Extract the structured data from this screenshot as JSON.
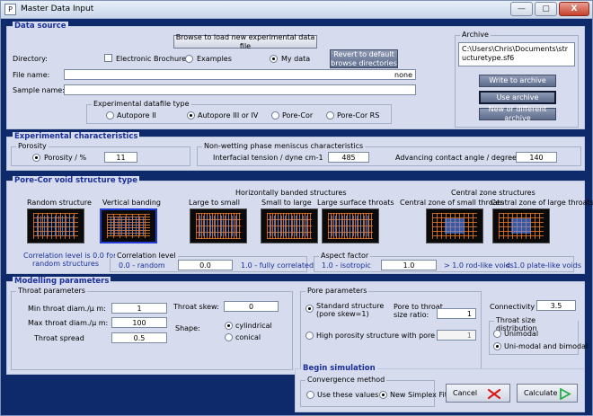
{
  "window": {
    "title": "Master Data Input",
    "min_label": "—",
    "max_label": "▢",
    "close_label": "X"
  },
  "data_source": {
    "legend": "Data source",
    "browse_button": "Browse to load new experimental data file",
    "directory_label": "Directory:",
    "electronic_brochure": "Electronic Brochure",
    "examples": "Examples",
    "my_data": "My data",
    "revert_button_line1": "Revert to default",
    "revert_button_line2": "browse directories",
    "file_name_label": "File name:",
    "file_name_value": "none",
    "sample_name_label": "Sample name:",
    "sample_name_value": "",
    "datafile_type_label": "Experimental datafile type",
    "types": [
      "Autopore II",
      "Autopore III or IV",
      "Pore-Cor",
      "Pore-Cor RS"
    ],
    "selected_type": "Autopore III or IV"
  },
  "archive": {
    "label": "Archive",
    "path": "C:\\Users\\Chris\\Documents\\structuretype.sf6",
    "write_button": "Write to archive",
    "use_button": "Use archive",
    "new_button": "New or different archive"
  },
  "experimental": {
    "legend": "Experimental characteristics",
    "porosity_group": "Porosity",
    "porosity_label": "Porosity / %",
    "porosity_value": "11",
    "meniscus_group": "Non-wetting phase meniscus characteristics",
    "tension_label": "Interfacial tension  / dyne cm-1",
    "tension_value": "485",
    "angle_label": "Advancing contact angle / degrees",
    "angle_value": "140"
  },
  "void_structure": {
    "legend": "Pore-Cor void structure type",
    "horiz_header": "Horizontally banded structures",
    "central_header": "Central zone structures",
    "types": [
      {
        "label": "Random structure",
        "icon": "random-structure-icon"
      },
      {
        "label": "Vertical banding",
        "icon": "vertical-banding-icon"
      },
      {
        "label": "Large to small",
        "icon": "large-to-small-icon"
      },
      {
        "label": "Small to large",
        "icon": "small-to-large-icon"
      },
      {
        "label": "Large surface throats",
        "icon": "large-surface-throats-icon"
      },
      {
        "label": "Central zone of small throats",
        "icon": "central-small-throats-icon"
      },
      {
        "label": "Central zone of large throats",
        "icon": "central-large-throats-icon"
      }
    ],
    "selected": "Vertical banding",
    "random_note_line1": "Correlation level is 0.0 for",
    "random_note_line2": "random structures",
    "correlation_group": "Correlation level",
    "corr_min_label": "0.0 - random",
    "corr_value": "0.0",
    "corr_max_label": "1.0 - fully correlated",
    "aspect_group": "Aspect factor",
    "aspect_iso_label": "1.0 - isotropic",
    "aspect_value": "1.0",
    "aspect_rod_label": "> 1.0  rod-like voids",
    "aspect_plate_label": "< 1.0  plate-like voids"
  },
  "modelling": {
    "legend": "Modelling parameters",
    "throat_group": "Throat parameters",
    "min_throat_label": "Min throat diam./µ m:",
    "min_throat_value": "1",
    "max_throat_label": "Max throat diam./µ m:",
    "max_throat_value": "100",
    "spread_label": "Throat spread",
    "spread_value": "0.5",
    "skew_label": "Throat skew:",
    "skew_value": "0",
    "shape_label": "Shape:",
    "shape_options": [
      "cylindrical",
      "conical"
    ],
    "shape_selected": "cylindrical",
    "pore_group": "Pore parameters",
    "standard_line1": "Standard structure",
    "standard_line2": "(pore skew=1)",
    "ratio_line1": "Pore to throat",
    "ratio_line2": "size ratio:",
    "ratio_value": "1",
    "high_porosity_label": "High porosity structure with pore skew:",
    "high_porosity_value": "1",
    "connectivity_label": "Connectivity",
    "connectivity_value": "3.5",
    "distribution_group": "Throat size distribution",
    "distribution_options": [
      "Unimodal",
      "Uni-modal and bimodal"
    ],
    "distribution_selected": "Uni-modal and bimodal"
  },
  "simulation": {
    "legend": "Begin simulation",
    "convergence_group": "Convergence method",
    "use_values": "Use these values",
    "new_simplex": "New Simplex Fit",
    "selected": "New Simplex Fit",
    "cancel_button": "Cancel",
    "calculate_button": "Calculate",
    "cancel_color": "#d81b1b",
    "calculate_color": "#22b04a"
  }
}
